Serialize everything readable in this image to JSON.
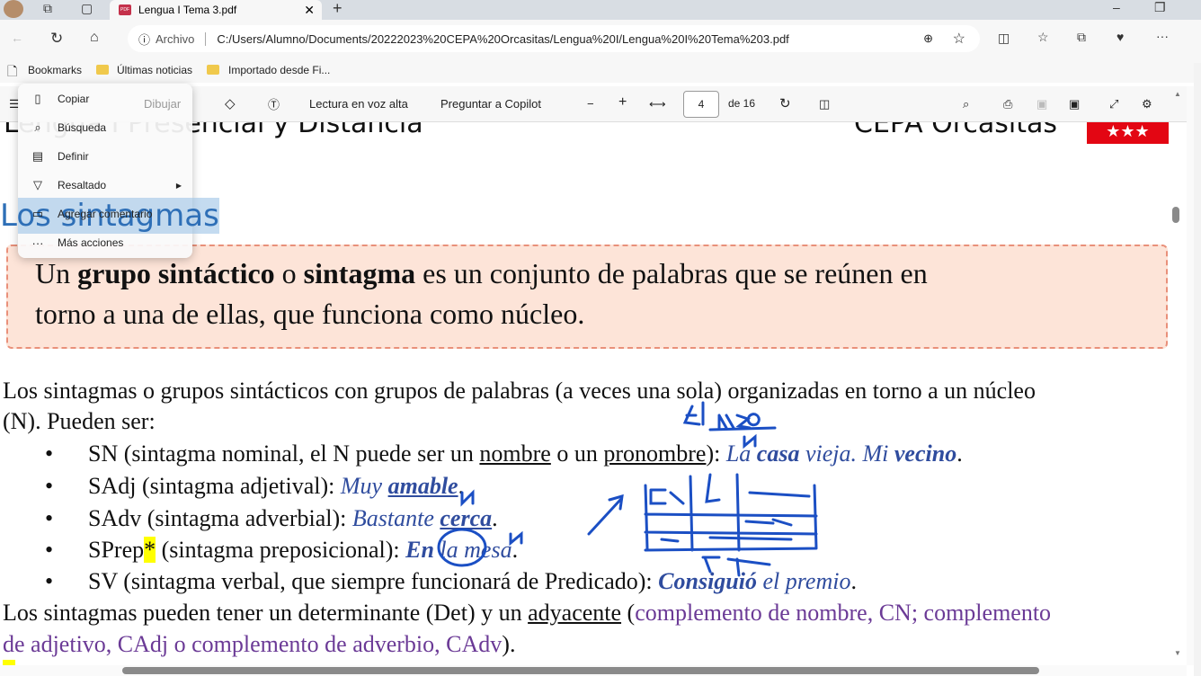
{
  "browser": {
    "tab_title": "Lengua I Tema 3.pdf",
    "address_label": "Archivo",
    "url": "C:/Users/Alumno/Documents/20222023%20CEPA%20Orcasitas/Lengua%20I/Lengua%20I%20Tema%203.pdf",
    "bookmarks": [
      "Bookmarks",
      "Últimas noticias",
      "Importado desde Fi..."
    ]
  },
  "pdf_toolbar": {
    "draw": "Dibujar",
    "read_aloud": "Lectura en voz alta",
    "ask_copilot": "Preguntar a Copilot",
    "page": "4",
    "of_pages": "de 16"
  },
  "context_menu": [
    {
      "label": "Copiar",
      "icon": "copy-icon"
    },
    {
      "label": "Búsqueda",
      "icon": "search-icon"
    },
    {
      "label": "Definir",
      "icon": "book-icon"
    },
    {
      "label": "Resaltado",
      "icon": "highlighter-icon"
    },
    {
      "label": "Agregar comentario",
      "icon": "comment-icon"
    },
    {
      "label": "Más acciones",
      "icon": "more-icon"
    }
  ],
  "doc": {
    "header_left": "Lengua I Presencial y Distancia",
    "header_right": "CEPA Orcasitas",
    "stars": "★★★",
    "title": "Los sintagmas",
    "def": {
      "a": "Un ",
      "b": "grupo sintáctico",
      "c": " o ",
      "d": "sintagma",
      "e": " es un conjunto de palabras que se reúnen en",
      "f": "torno a una de ellas, que funciona como núcleo."
    },
    "p1a": "Los sintagmas o grupos sintácticos con grupos de palabras (a veces una sola) organizadas en torno a un núcleo",
    "p1b": "(N). Pueden ser:",
    "sn": {
      "t1": "SN (sintagma nominal, el N puede ser un ",
      "u1": "nombre",
      "t2": " o un ",
      "u2": "pronombre",
      "t3": "): ",
      "ex1": "La ",
      "ex2": "casa",
      "ex3": " vieja. Mi ",
      "ex4": "vecino",
      "ex5": "."
    },
    "sadj": {
      "t": "SAdj (sintagma adjetival): ",
      "ex1": "Muy ",
      "ex2": "amable",
      "ex3": "."
    },
    "sadv": {
      "t": "SAdv (sintagma adverbial): ",
      "ex1": "Bastante ",
      "ex2": "cerca",
      "ex3": "."
    },
    "sprep": {
      "t1": "SPrep",
      "star": "*",
      "t2": " (sintagma preposicional): ",
      "ex1": "En",
      "ex2": " la mesa",
      "ex3": "."
    },
    "sv": {
      "t": "SV (sintagma verbal, que siempre funcionará de Predicado): ",
      "ex1": "Consiguió",
      "ex2": " el premio",
      "ex3": "."
    },
    "p2a": "Los sintagmas pueden tener un determinante (Det) y un ",
    "p2u": "adyacente",
    "p2b": " (",
    "p2c": "complemento de nombre, CN; complemento",
    "p2d": "de adjetivo, CAdj o complemento de adverbio, CAdv",
    "p2e": ")."
  },
  "colors": {
    "title": "#2e6fb7",
    "example": "#2f4c9e",
    "adjacent": "#6b3a96",
    "ink": "#1b4fc4",
    "box_bg": "#fde4d8"
  }
}
